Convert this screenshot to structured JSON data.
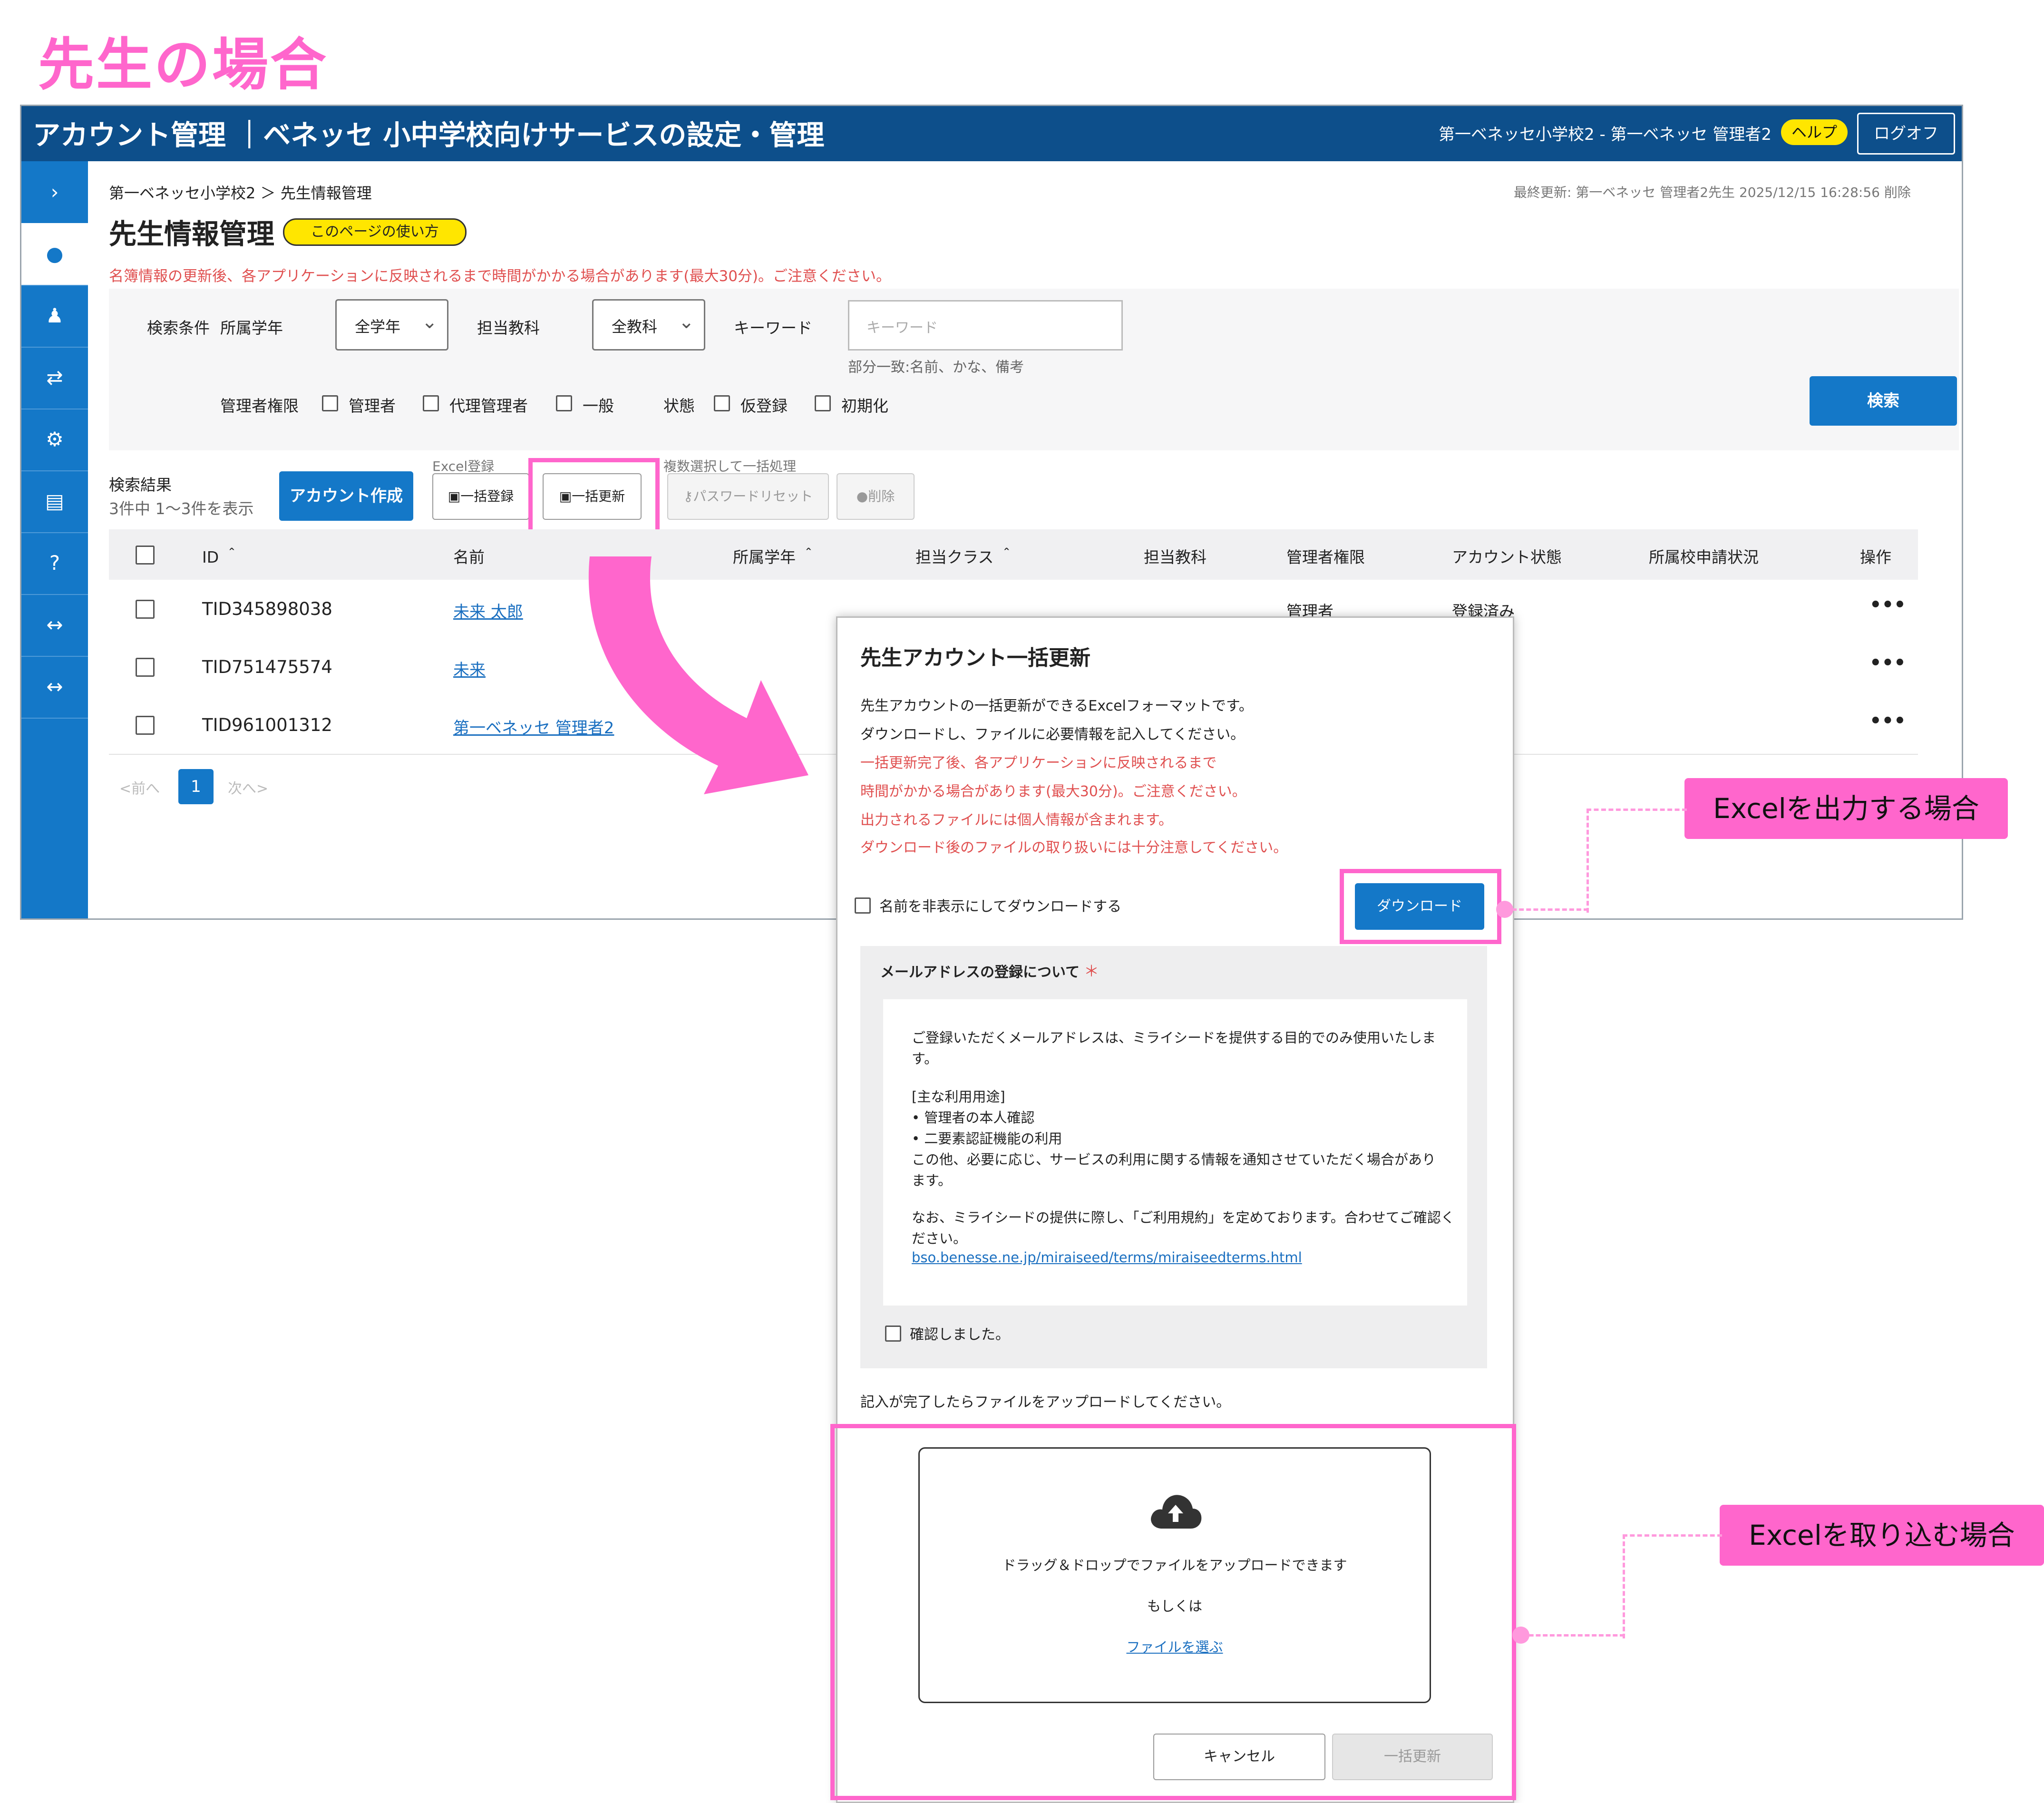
{
  "page_heading": "先生の場合",
  "app": {
    "header": {
      "title": "アカウント管理 ｜ベネッセ 小中学校向けサービスの設定・管理",
      "school_user": "第一ベネッセ小学校2 - 第一ベネッセ  管理者2",
      "help": "ヘルプ",
      "logoff": "ログオフ"
    },
    "sidebar_icons": [
      "chevron-right-icon",
      "user-icon",
      "person-icon",
      "swap-icon",
      "gear-icon",
      "file-icon",
      "help-icon",
      "arrows-icon",
      "arrows-icon"
    ],
    "breadcrumb": "第一ベネッセ小学校2  ＞  先生情報管理",
    "last_update": "最終更新: 第一ベネッセ  管理者2先生  2025/12/15 16:28:56 削除",
    "title": "先生情報管理",
    "howto": "このページの使い方",
    "notice": "名簿情報の更新後、各アプリケーションに反映されるまで時間がかかる場合があります(最大30分)。ご注意ください。",
    "search": {
      "label": "検索条件",
      "grade_label": "所属学年",
      "grade_value": "全学年",
      "subject_label": "担当教科",
      "subject_value": "全教科",
      "keyword_label": "キーワード",
      "keyword_placeholder": "キーワード",
      "keyword_hint": "部分一致:名前、かな、備考",
      "role_label": "管理者権限",
      "roles": [
        "管理者",
        "代理管理者",
        "一般"
      ],
      "status_label": "状態",
      "statuses": [
        "仮登録",
        "初期化"
      ],
      "search_button": "検索"
    },
    "results": {
      "label": "検索結果",
      "count": "3件中 1〜3件を表示",
      "create_button": "アカウント作成",
      "excel_label": "Excel登録",
      "bulk_register": "一括登録",
      "bulk_update": "一括更新",
      "multi_label": "複数選択して一括処理",
      "password_reset": "パスワードリセット",
      "delete": "削除"
    },
    "table": {
      "headers": [
        "ID ＾",
        "名前",
        "所属学年 ＾",
        "担当クラス ＾",
        "担当教科",
        "管理者権限",
        "アカウント状態",
        "所属校申請状況",
        "操作"
      ],
      "rows": [
        {
          "id": "TID345898038",
          "name": "未来  太郎",
          "role": "管理者",
          "status": "登録済み",
          "ops": "•••"
        },
        {
          "id": "TID751475574",
          "name": "未来",
          "role": "",
          "status": "",
          "ops": "•••"
        },
        {
          "id": "TID961001312",
          "name": "第一ベネッセ  管理者2",
          "role": "",
          "status": "",
          "ops": "•••"
        }
      ]
    },
    "pager": {
      "prev": "<前へ",
      "page": "1",
      "next": "次へ>"
    }
  },
  "modal": {
    "title": "先生アカウント一括更新",
    "lines": [
      "先生アカウントの一括更新ができるExcelフォーマットです。",
      "ダウンロードし、ファイルに必要情報を記入してください。"
    ],
    "red_lines": [
      "一括更新完了後、各アプリケーションに反映されるまで",
      "時間がかかる場合があります(最大30分)。ご注意ください。",
      "出力されるファイルには個人情報が含まれます。",
      "ダウンロード後のファイルの取り扱いには十分注意してください。"
    ],
    "hide_name": "名前を非表示にしてダウンロードする",
    "download": "ダウンロード",
    "consent_title": "メールアドレスの登録について",
    "required_mark": "＊",
    "consent_lines": [
      "ご登録いただくメールアドレスは、ミライシードを提供する目的でのみ使用いたしま",
      "す。",
      "",
      "[主な利用用途]",
      "•  管理者の本人確認",
      "•  二要素認証機能の利用",
      "この他、必要に応じ、サービスの利用に関する情報を通知させていただく場合があり",
      "ます。",
      "",
      "なお、ミライシードの提供に際し、「ご利用規約」を定めております。合わせてご確認く",
      "ださい。"
    ],
    "consent_link": "bso.benesse.ne.jp/miraiseed/terms/miraiseedterms.html",
    "confirmed": "確認しました。",
    "upload_instruction": "記入が完了したらファイルをアップロードしてください。",
    "drop_text": "ドラッグ＆ドロップでファイルをアップロードできます",
    "or_text": "もしくは",
    "choose_file": "ファイルを選ぶ",
    "cancel": "キャンセル",
    "submit": "一括更新"
  },
  "callouts": {
    "export": "Excelを出力する場合",
    "import": "Excelを取り込む場合"
  },
  "colors": {
    "accent_pink": "#ff66cc",
    "header_navy": "#0d4f8b",
    "primary_blue": "#1478c8",
    "help_yellow": "#ffe600",
    "warning_red": "#e05050"
  }
}
